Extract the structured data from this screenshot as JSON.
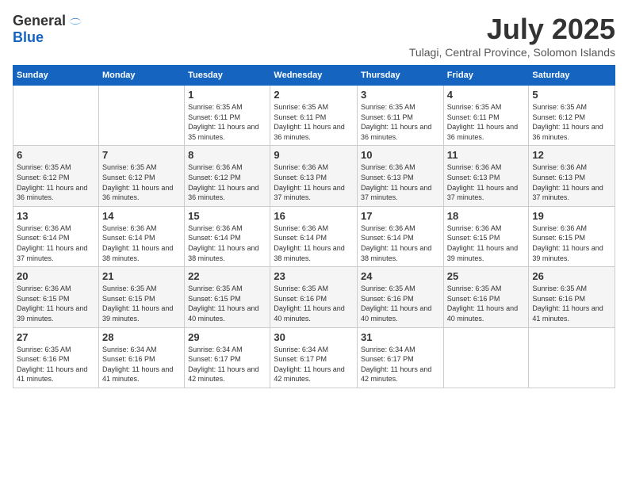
{
  "logo": {
    "general": "General",
    "blue": "Blue"
  },
  "title": "July 2025",
  "subtitle": "Tulagi, Central Province, Solomon Islands",
  "days_of_week": [
    "Sunday",
    "Monday",
    "Tuesday",
    "Wednesday",
    "Thursday",
    "Friday",
    "Saturday"
  ],
  "weeks": [
    [
      {
        "day": "",
        "info": ""
      },
      {
        "day": "",
        "info": ""
      },
      {
        "day": "1",
        "info": "Sunrise: 6:35 AM\nSunset: 6:11 PM\nDaylight: 11 hours and 35 minutes."
      },
      {
        "day": "2",
        "info": "Sunrise: 6:35 AM\nSunset: 6:11 PM\nDaylight: 11 hours and 36 minutes."
      },
      {
        "day": "3",
        "info": "Sunrise: 6:35 AM\nSunset: 6:11 PM\nDaylight: 11 hours and 36 minutes."
      },
      {
        "day": "4",
        "info": "Sunrise: 6:35 AM\nSunset: 6:11 PM\nDaylight: 11 hours and 36 minutes."
      },
      {
        "day": "5",
        "info": "Sunrise: 6:35 AM\nSunset: 6:12 PM\nDaylight: 11 hours and 36 minutes."
      }
    ],
    [
      {
        "day": "6",
        "info": "Sunrise: 6:35 AM\nSunset: 6:12 PM\nDaylight: 11 hours and 36 minutes."
      },
      {
        "day": "7",
        "info": "Sunrise: 6:35 AM\nSunset: 6:12 PM\nDaylight: 11 hours and 36 minutes."
      },
      {
        "day": "8",
        "info": "Sunrise: 6:36 AM\nSunset: 6:12 PM\nDaylight: 11 hours and 36 minutes."
      },
      {
        "day": "9",
        "info": "Sunrise: 6:36 AM\nSunset: 6:13 PM\nDaylight: 11 hours and 37 minutes."
      },
      {
        "day": "10",
        "info": "Sunrise: 6:36 AM\nSunset: 6:13 PM\nDaylight: 11 hours and 37 minutes."
      },
      {
        "day": "11",
        "info": "Sunrise: 6:36 AM\nSunset: 6:13 PM\nDaylight: 11 hours and 37 minutes."
      },
      {
        "day": "12",
        "info": "Sunrise: 6:36 AM\nSunset: 6:13 PM\nDaylight: 11 hours and 37 minutes."
      }
    ],
    [
      {
        "day": "13",
        "info": "Sunrise: 6:36 AM\nSunset: 6:14 PM\nDaylight: 11 hours and 37 minutes."
      },
      {
        "day": "14",
        "info": "Sunrise: 6:36 AM\nSunset: 6:14 PM\nDaylight: 11 hours and 38 minutes."
      },
      {
        "day": "15",
        "info": "Sunrise: 6:36 AM\nSunset: 6:14 PM\nDaylight: 11 hours and 38 minutes."
      },
      {
        "day": "16",
        "info": "Sunrise: 6:36 AM\nSunset: 6:14 PM\nDaylight: 11 hours and 38 minutes."
      },
      {
        "day": "17",
        "info": "Sunrise: 6:36 AM\nSunset: 6:14 PM\nDaylight: 11 hours and 38 minutes."
      },
      {
        "day": "18",
        "info": "Sunrise: 6:36 AM\nSunset: 6:15 PM\nDaylight: 11 hours and 39 minutes."
      },
      {
        "day": "19",
        "info": "Sunrise: 6:36 AM\nSunset: 6:15 PM\nDaylight: 11 hours and 39 minutes."
      }
    ],
    [
      {
        "day": "20",
        "info": "Sunrise: 6:36 AM\nSunset: 6:15 PM\nDaylight: 11 hours and 39 minutes."
      },
      {
        "day": "21",
        "info": "Sunrise: 6:35 AM\nSunset: 6:15 PM\nDaylight: 11 hours and 39 minutes."
      },
      {
        "day": "22",
        "info": "Sunrise: 6:35 AM\nSunset: 6:15 PM\nDaylight: 11 hours and 40 minutes."
      },
      {
        "day": "23",
        "info": "Sunrise: 6:35 AM\nSunset: 6:16 PM\nDaylight: 11 hours and 40 minutes."
      },
      {
        "day": "24",
        "info": "Sunrise: 6:35 AM\nSunset: 6:16 PM\nDaylight: 11 hours and 40 minutes."
      },
      {
        "day": "25",
        "info": "Sunrise: 6:35 AM\nSunset: 6:16 PM\nDaylight: 11 hours and 40 minutes."
      },
      {
        "day": "26",
        "info": "Sunrise: 6:35 AM\nSunset: 6:16 PM\nDaylight: 11 hours and 41 minutes."
      }
    ],
    [
      {
        "day": "27",
        "info": "Sunrise: 6:35 AM\nSunset: 6:16 PM\nDaylight: 11 hours and 41 minutes."
      },
      {
        "day": "28",
        "info": "Sunrise: 6:34 AM\nSunset: 6:16 PM\nDaylight: 11 hours and 41 minutes."
      },
      {
        "day": "29",
        "info": "Sunrise: 6:34 AM\nSunset: 6:17 PM\nDaylight: 11 hours and 42 minutes."
      },
      {
        "day": "30",
        "info": "Sunrise: 6:34 AM\nSunset: 6:17 PM\nDaylight: 11 hours and 42 minutes."
      },
      {
        "day": "31",
        "info": "Sunrise: 6:34 AM\nSunset: 6:17 PM\nDaylight: 11 hours and 42 minutes."
      },
      {
        "day": "",
        "info": ""
      },
      {
        "day": "",
        "info": ""
      }
    ]
  ]
}
